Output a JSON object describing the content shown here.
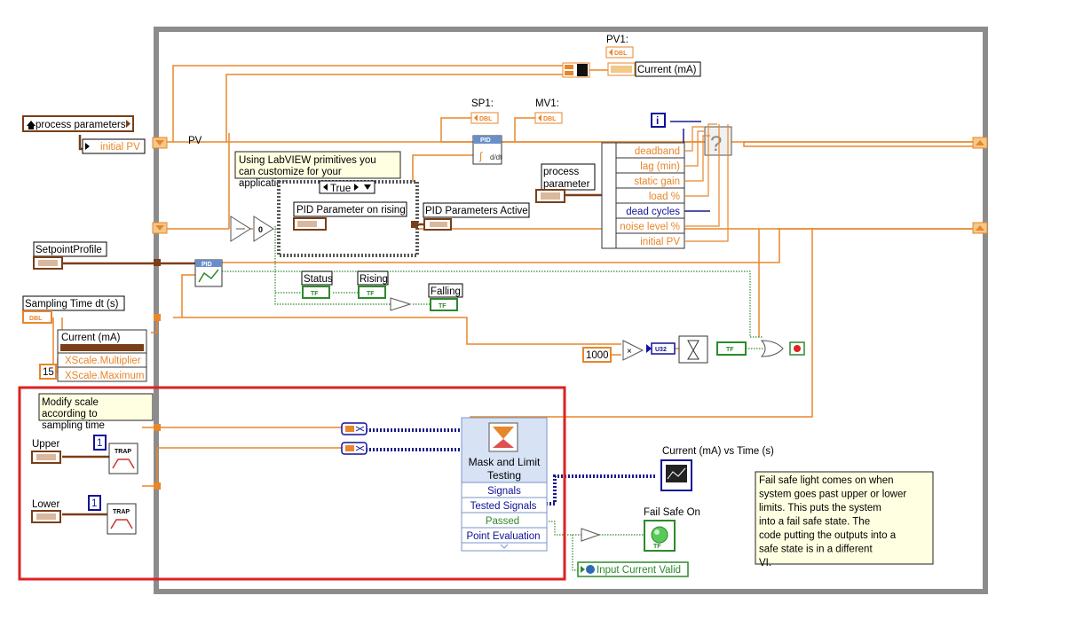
{
  "labels": {
    "pv1": "PV1:",
    "current_out": "Current (mA)",
    "sp1": "SP1:",
    "mv1": "MV1:",
    "pv": "PV",
    "process_parameters": "process parameters",
    "initial_pv": "initial PV",
    "comment_customize": "Using LabVIEW primitives you can customize for your application",
    "case_selector": "True",
    "pid_rising": "PID Parameter on rising",
    "pid_active": "PID Parameters Active",
    "process_parameter_line1": "process",
    "process_parameter_line2": "parameter",
    "setpoint_profile": "SetpointProfile",
    "sampling_time": "Sampling Time dt (s)",
    "status": "Status",
    "rising": "Rising",
    "falling": "Falling",
    "current_chart": "Current (mA)",
    "xscale_multiplier": "XScale.Multiplier",
    "xscale_maximum": "XScale.Maximum",
    "const_15": "15",
    "const_1000": "1000",
    "comment_modify_scale": "Modify scale according to sampling time",
    "upper": "Upper",
    "lower": "Lower",
    "const_1_upper": "1",
    "const_1_lower": "1",
    "mask_limit": "Mask and Limit Testing",
    "signals": "Signals",
    "tested_signals": "Tested Signals",
    "passed": "Passed",
    "point_evaluation": "Point Evaluation",
    "current_vs_time": "Current (mA) vs Time (s)",
    "fail_safe_on": "Fail Safe On",
    "input_current_valid": "Input Current Valid",
    "comment_failsafe": "Fail safe light comes on when system goes past upper or lower limits. This puts the system into a fail safe state. The code putting the outputs into a safe state is in a different VI."
  },
  "bundle_items": [
    "deadband",
    "lag (min)",
    "static gain",
    "load %",
    "dead cycles",
    "noise level %",
    "initial PV"
  ],
  "glyphs": {
    "dbl": "DBL",
    "tf": "TF",
    "u32": "U32",
    "pid": "PID",
    "trap": "TRAP",
    "i": "i",
    "question": "?",
    "zero": "0",
    "select": "?"
  },
  "colors": {
    "wire_orange": "#e8862a",
    "wire_blue": "#1a1a8c",
    "wire_green": "#2c8a2c",
    "wire_brown": "#7a3e18",
    "frame": "#8c8c8c",
    "highlight": "#dd2222",
    "comment_bg": "#ffffe1"
  }
}
